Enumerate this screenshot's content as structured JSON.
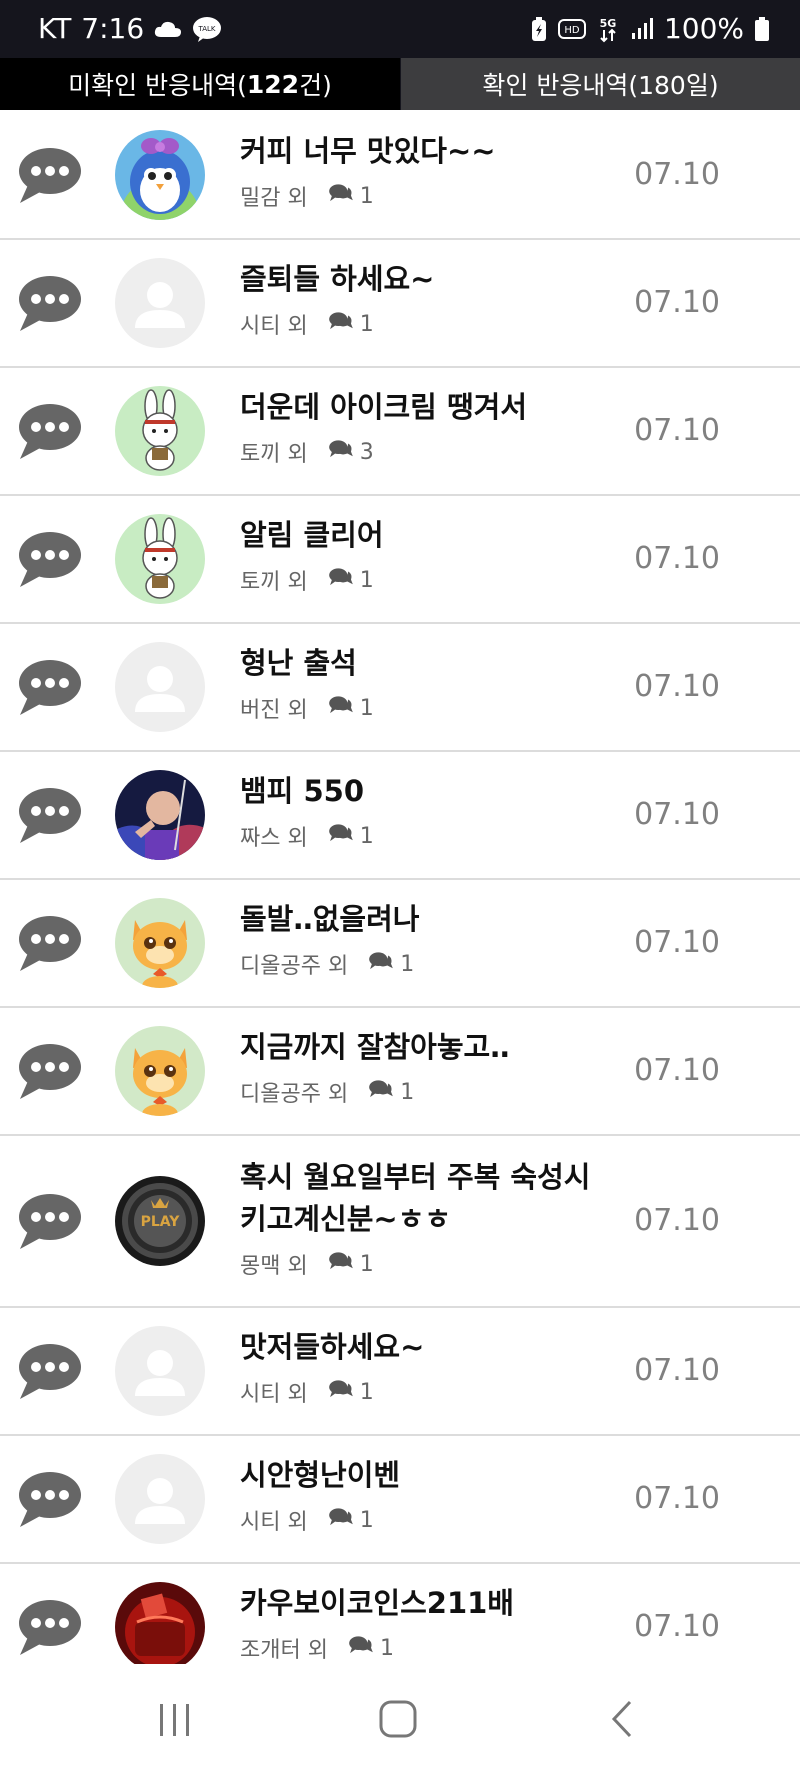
{
  "status_bar": {
    "carrier": "KT",
    "time": "7:16",
    "battery": "100%",
    "icons": [
      "cloud-icon",
      "talk-icon",
      "battery-saver-icon",
      "hd-icon",
      "5g-icon",
      "signal-icon",
      "battery-icon"
    ]
  },
  "tabs": {
    "unread_label": "미확인 반응내역(",
    "unread_count": "122",
    "unread_suffix": "건)",
    "read_label": "확인 반응내역(180일)"
  },
  "colors": {
    "bar": "#15151d",
    "tab_active": "#000000",
    "tab_inactive": "#3d3d3f",
    "bubble": "#666666",
    "date": "#808080"
  },
  "items": [
    {
      "title": "커피 너무 맛있다~~",
      "user": "밀감 외",
      "count": "1",
      "date": "07.10",
      "avatar": "penguin"
    },
    {
      "title": "즐퇴들 하세요~",
      "user": "시티 외",
      "count": "1",
      "date": "07.10",
      "avatar": "default"
    },
    {
      "title": "더운데 아이크림 땡겨서",
      "user": "토끼 외",
      "count": "3",
      "date": "07.10",
      "avatar": "rabbit"
    },
    {
      "title": "알림 클리어",
      "user": "토끼 외",
      "count": "1",
      "date": "07.10",
      "avatar": "rabbit"
    },
    {
      "title": "형난 출석",
      "user": "버진 외",
      "count": "1",
      "date": "07.10",
      "avatar": "default"
    },
    {
      "title": "뱀피 550",
      "user": "짜스 외",
      "count": "1",
      "date": "07.10",
      "avatar": "person"
    },
    {
      "title": "돌발‥없을려나",
      "user": "디올공주 외",
      "count": "1",
      "date": "07.10",
      "avatar": "cat"
    },
    {
      "title": "지금까지 잘참아놓고‥",
      "user": "디올공주 외",
      "count": "1",
      "date": "07.10",
      "avatar": "cat"
    },
    {
      "title": "혹시 월요일부터 주복 숙성시 키고계신분~ㅎㅎ",
      "user": "몽맥 외",
      "count": "1",
      "date": "07.10",
      "avatar": "play"
    },
    {
      "title": "맛저들하세요~",
      "user": "시티 외",
      "count": "1",
      "date": "07.10",
      "avatar": "default"
    },
    {
      "title": "시안형난이벤",
      "user": "시티 외",
      "count": "1",
      "date": "07.10",
      "avatar": "default"
    },
    {
      "title": "카우보이코인스211배",
      "user": "조개터 외",
      "count": "1",
      "date": "07.10",
      "avatar": "red"
    }
  ],
  "nav": [
    "recent-apps-icon",
    "home-icon",
    "back-icon"
  ]
}
